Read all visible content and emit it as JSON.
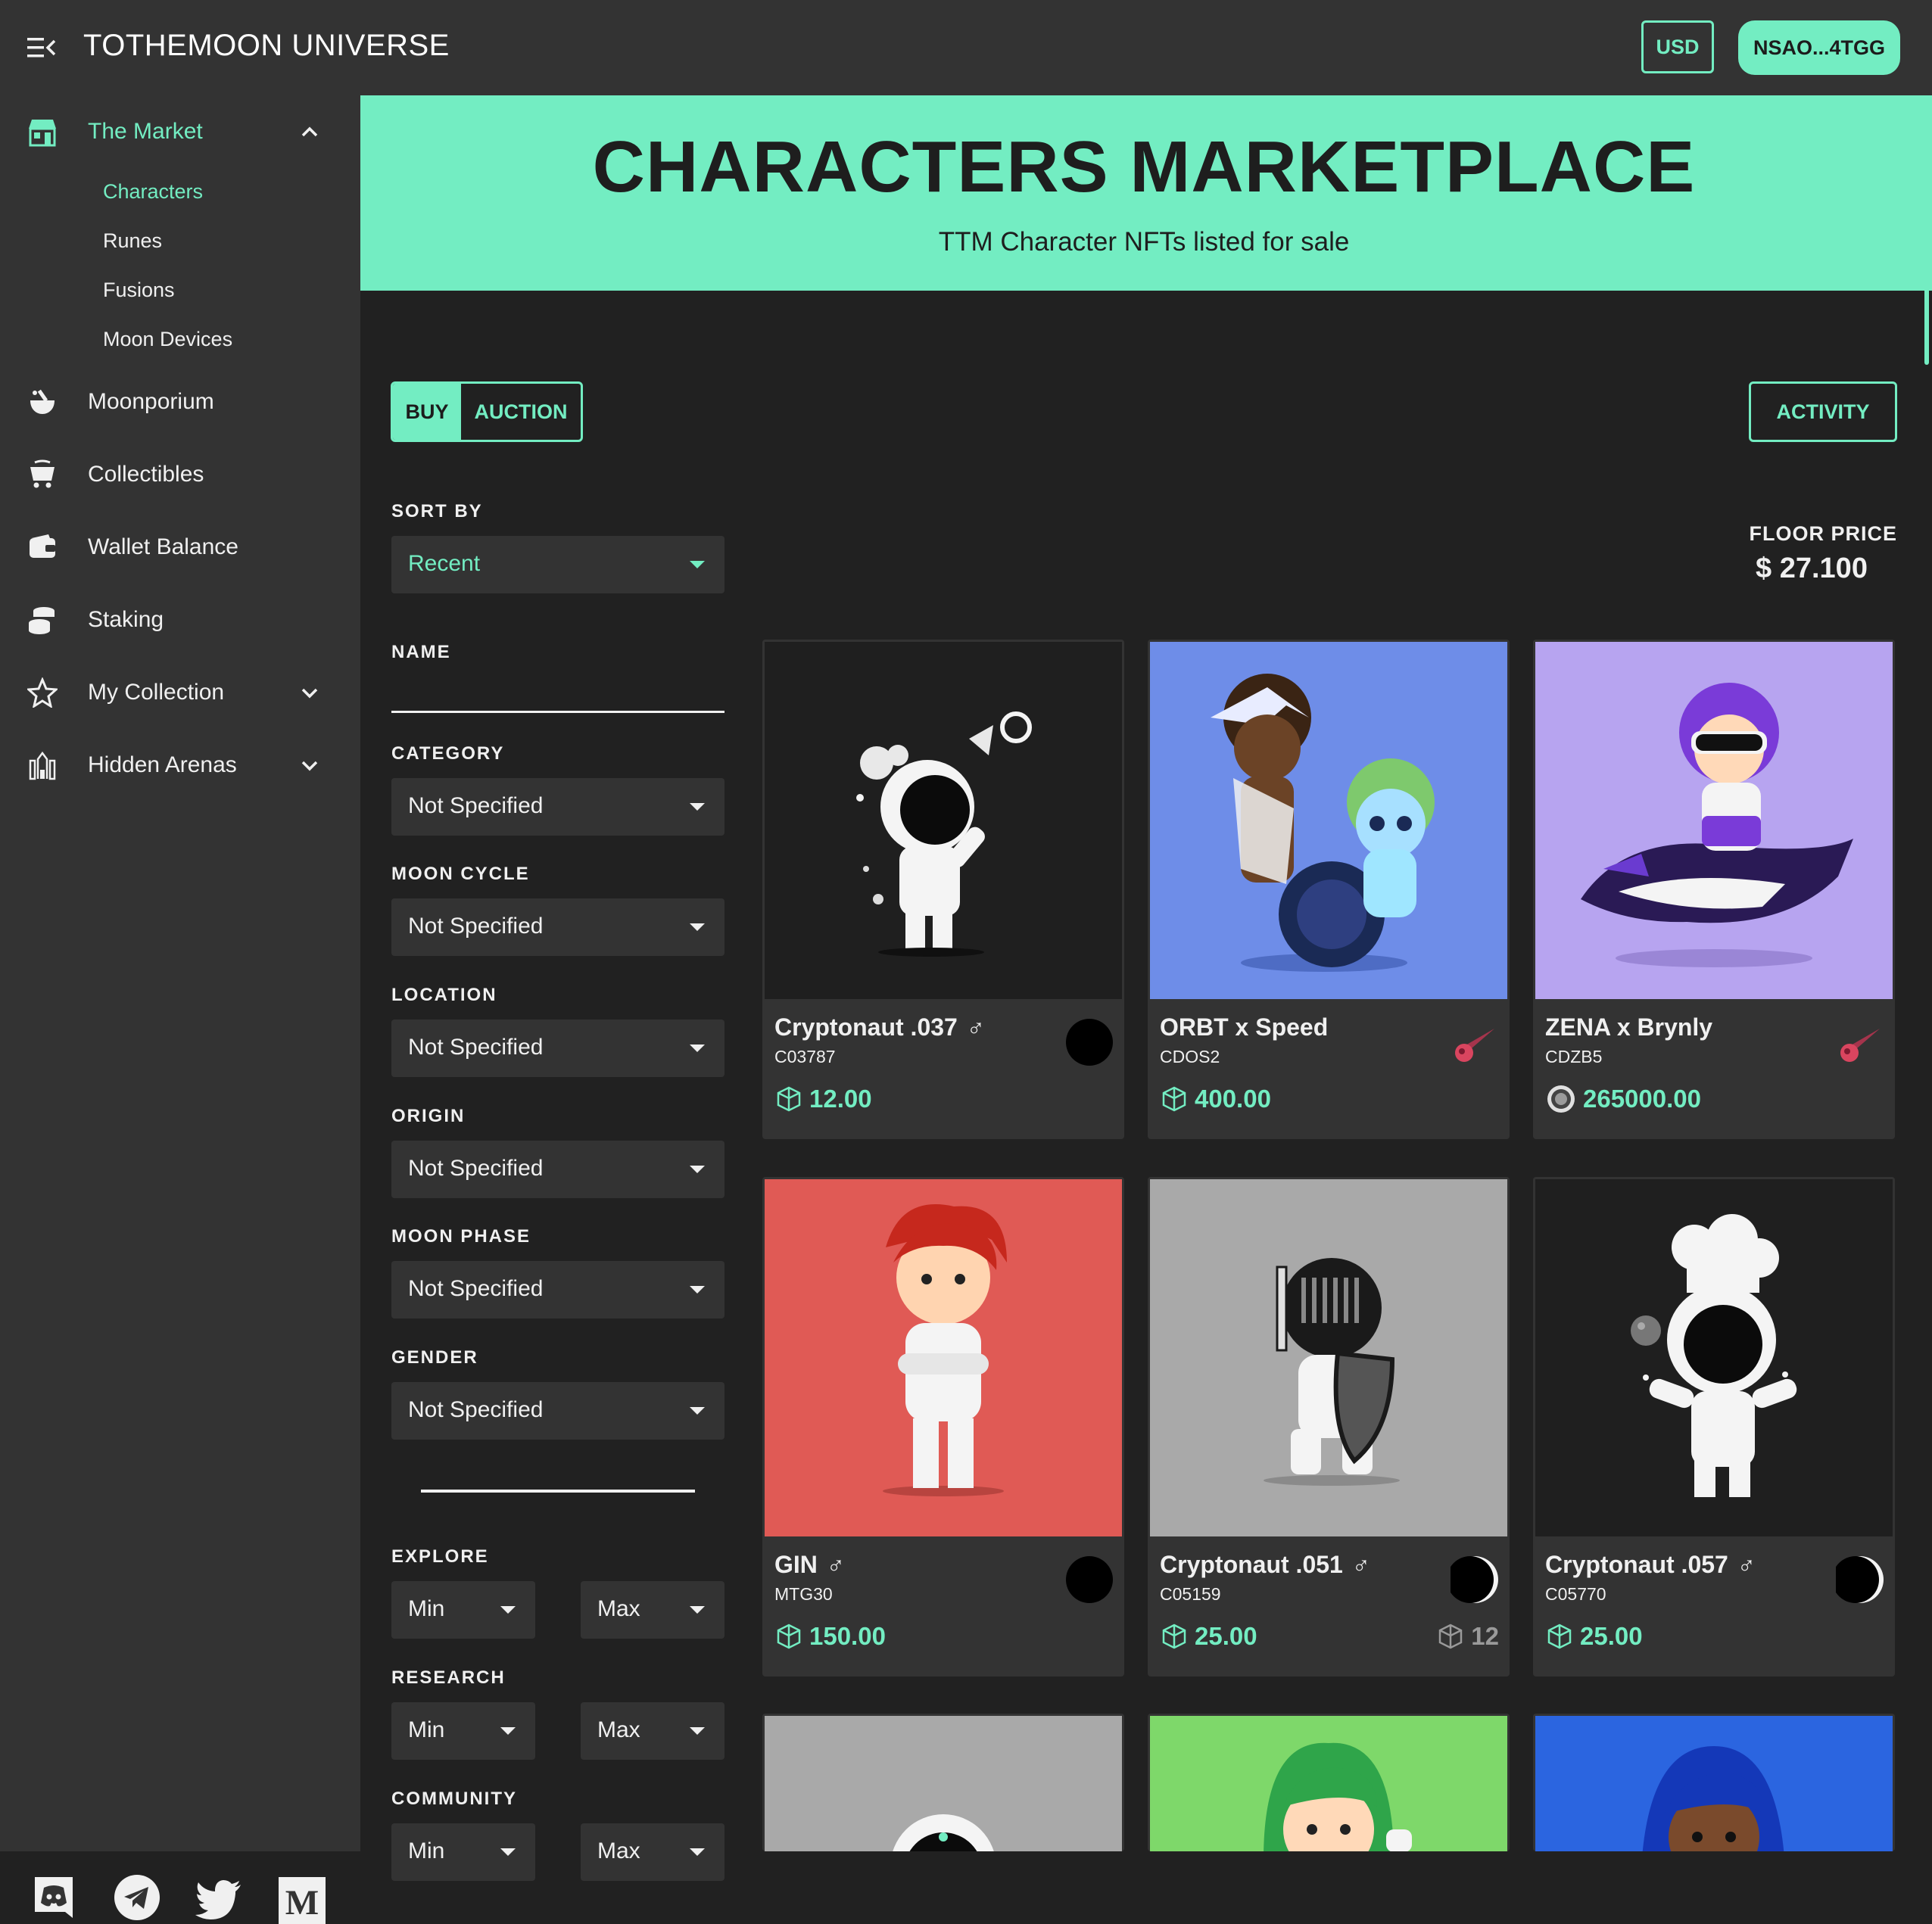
{
  "header": {
    "title": "TOTHEMOON UNIVERSE",
    "currency_label": "USD",
    "wallet_label": "NSAO...4TGG"
  },
  "sidebar": {
    "items": [
      {
        "label": "The Market",
        "icon": "market-icon",
        "active": true,
        "expanded": true
      },
      {
        "label": "Moonporium",
        "icon": "mortar-icon"
      },
      {
        "label": "Collectibles",
        "icon": "cart-icon"
      },
      {
        "label": "Wallet Balance",
        "icon": "wallet-icon"
      },
      {
        "label": "Staking",
        "icon": "coins-icon"
      },
      {
        "label": "My Collection",
        "icon": "star-icon"
      },
      {
        "label": "Hidden Arenas",
        "icon": "castle-icon"
      }
    ],
    "market_sub": [
      "Characters",
      "Runes",
      "Fusions",
      "Moon Devices"
    ],
    "socials": [
      "discord-icon",
      "telegram-icon",
      "twitter-icon",
      "medium-icon"
    ]
  },
  "hero": {
    "title": "CHARACTERS MARKETPLACE",
    "subtitle": "TTM Character NFTs listed for sale"
  },
  "toolbar": {
    "buy_label": "BUY",
    "auction_label": "AUCTION",
    "activity_label": "ACTIVITY"
  },
  "filters": {
    "sort_by": {
      "label": "SORT BY",
      "value": "Recent"
    },
    "name": {
      "label": "NAME",
      "value": ""
    },
    "category": {
      "label": "CATEGORY",
      "value": "Not Specified"
    },
    "moon_cycle": {
      "label": "MOON CYCLE",
      "value": "Not Specified"
    },
    "location": {
      "label": "LOCATION",
      "value": "Not Specified"
    },
    "origin": {
      "label": "ORIGIN",
      "value": "Not Specified"
    },
    "moon_phase": {
      "label": "MOON PHASE",
      "value": "Not Specified"
    },
    "gender": {
      "label": "GENDER",
      "value": "Not Specified"
    },
    "explore": {
      "label": "EXPLORE",
      "min": "Min",
      "max": "Max"
    },
    "research": {
      "label": "RESEARCH",
      "min": "Min",
      "max": "Max"
    },
    "community": {
      "label": "COMMUNITY",
      "min": "Min",
      "max": "Max"
    }
  },
  "floor": {
    "label": "FLOOR PRICE",
    "value": "$ 27.100"
  },
  "cards": [
    {
      "name": "Cryptonaut .037",
      "gender": "♂",
      "code": "C03787",
      "price": "12.00",
      "currency": "cube",
      "badge": "new-moon",
      "bg": "#1f1f1f"
    },
    {
      "name": "ORBT x Speed",
      "gender": "",
      "code": "CDOS2",
      "price": "400.00",
      "currency": "cube",
      "badge": "comet",
      "bg": "#6e8de8"
    },
    {
      "name": "ZENA x Brynly",
      "gender": "",
      "code": "CDZB5",
      "price": "265000.00",
      "currency": "coin",
      "badge": "comet",
      "bg": "#b7a4f0"
    },
    {
      "name": "GIN",
      "gender": "♂",
      "code": "MTG30",
      "price": "150.00",
      "currency": "cube",
      "badge": "new-moon",
      "bg": "#e05a55"
    },
    {
      "name": "Cryptonaut .051",
      "gender": "♂",
      "code": "C05159",
      "price": "25.00",
      "currency": "cube",
      "badge": "crescent",
      "bg": "#a9a9a9",
      "secondary_price": "12"
    },
    {
      "name": "Cryptonaut .057",
      "gender": "♂",
      "code": "C05770",
      "price": "25.00",
      "currency": "cube",
      "badge": "crescent",
      "bg": "#1f1f1f"
    }
  ],
  "colors": {
    "accent": "#73edc2",
    "sidebar": "#333333",
    "background": "#212121"
  }
}
